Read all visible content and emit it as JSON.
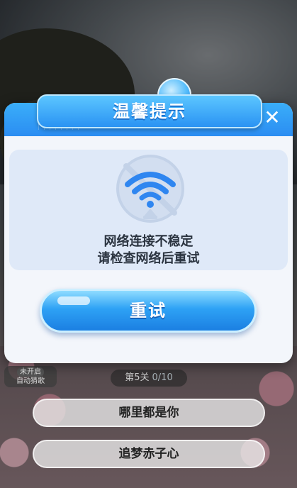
{
  "dialog": {
    "title": "温馨提示",
    "close_label": "✕",
    "message_line1": "网络连接不稳定",
    "message_line2": "请检查网络后重试",
    "retry_label": "重试",
    "icon": "no-wifi-icon"
  },
  "game": {
    "auto_guess_toggle": "未开启",
    "auto_guess_label": "自动猜歌",
    "level_label": "第5关",
    "level_progress": "0/10",
    "options": [
      {
        "label": "哪里都是你"
      },
      {
        "label": "追梦赤子心"
      }
    ]
  },
  "colors": {
    "primary": "#2b8df2",
    "header_light": "#5cc6ff",
    "panel_bg": "#dfe9f8",
    "text_dark": "#2b3440"
  }
}
